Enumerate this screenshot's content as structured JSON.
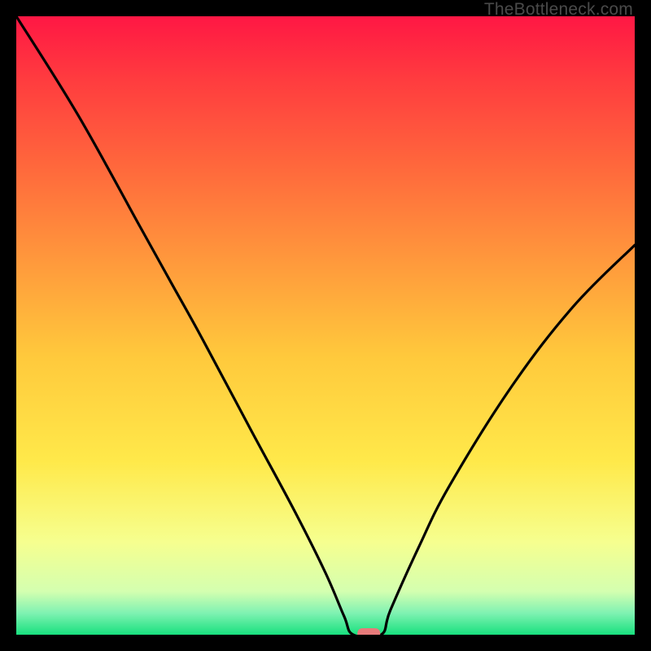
{
  "watermark": "TheBottleneck.com",
  "chart_data": {
    "type": "line",
    "title": "",
    "xlabel": "",
    "ylabel": "",
    "xlim": [
      0,
      100
    ],
    "ylim": [
      0,
      100
    ],
    "grid": false,
    "curve": [
      {
        "x": 0,
        "y": 100
      },
      {
        "x": 10,
        "y": 84
      },
      {
        "x": 20,
        "y": 66
      },
      {
        "x": 25,
        "y": 57
      },
      {
        "x": 30,
        "y": 48
      },
      {
        "x": 38,
        "y": 33
      },
      {
        "x": 45,
        "y": 20
      },
      {
        "x": 50,
        "y": 10
      },
      {
        "x": 53,
        "y": 3
      },
      {
        "x": 54.5,
        "y": 0
      },
      {
        "x": 59,
        "y": 0
      },
      {
        "x": 60.5,
        "y": 4
      },
      {
        "x": 65,
        "y": 14
      },
      {
        "x": 70,
        "y": 24
      },
      {
        "x": 80,
        "y": 40
      },
      {
        "x": 90,
        "y": 53
      },
      {
        "x": 100,
        "y": 63
      }
    ],
    "marker": {
      "x": 57,
      "y": 0,
      "color": "#e77a7a"
    },
    "background_gradient": {
      "stops": [
        {
          "offset": 0.0,
          "color": "#ff1744"
        },
        {
          "offset": 0.1,
          "color": "#ff3b3f"
        },
        {
          "offset": 0.25,
          "color": "#ff6a3c"
        },
        {
          "offset": 0.4,
          "color": "#ff9a3c"
        },
        {
          "offset": 0.55,
          "color": "#ffc93c"
        },
        {
          "offset": 0.72,
          "color": "#ffe94a"
        },
        {
          "offset": 0.85,
          "color": "#f6ff8f"
        },
        {
          "offset": 0.93,
          "color": "#d4ffb0"
        },
        {
          "offset": 0.965,
          "color": "#7ff2b2"
        },
        {
          "offset": 1.0,
          "color": "#18e07e"
        }
      ]
    }
  }
}
